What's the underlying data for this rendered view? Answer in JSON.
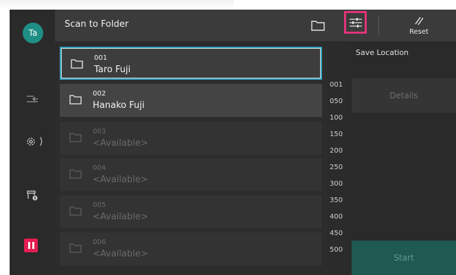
{
  "header": {
    "title": "Scan to Folder",
    "reset_label": "Reset"
  },
  "user": {
    "initials": "Ta"
  },
  "folders": [
    {
      "number": "001",
      "name": "Taro Fuji",
      "state": "selected"
    },
    {
      "number": "002",
      "name": "Hanako Fuji",
      "state": "filled"
    },
    {
      "number": "003",
      "name": "<Available>",
      "state": "empty"
    },
    {
      "number": "004",
      "name": "<Available>",
      "state": "empty"
    },
    {
      "number": "005",
      "name": "<Available>",
      "state": "empty"
    },
    {
      "number": "006",
      "name": "<Available>",
      "state": "empty"
    }
  ],
  "index_labels": [
    "001",
    "050",
    "100",
    "150",
    "200",
    "250",
    "300",
    "350",
    "400",
    "450",
    "500"
  ],
  "panel": {
    "save_location_label": "Save Location",
    "details_label": "Details",
    "start_label": "Start"
  },
  "colors": {
    "accent_teal": "#1f8f86",
    "selection_border": "#36a7c4",
    "highlight_pink": "#e3347a",
    "pause_red": "#e41e52"
  },
  "icons": {
    "header_folder": "folder-icon",
    "filter": "filter-sliders-icon",
    "reset": "reset-icon",
    "rail_1": "sign-in-icon",
    "rail_2": "settings-gear-icon",
    "rail_3": "device-info-icon",
    "rail_4": "pause-icon"
  }
}
